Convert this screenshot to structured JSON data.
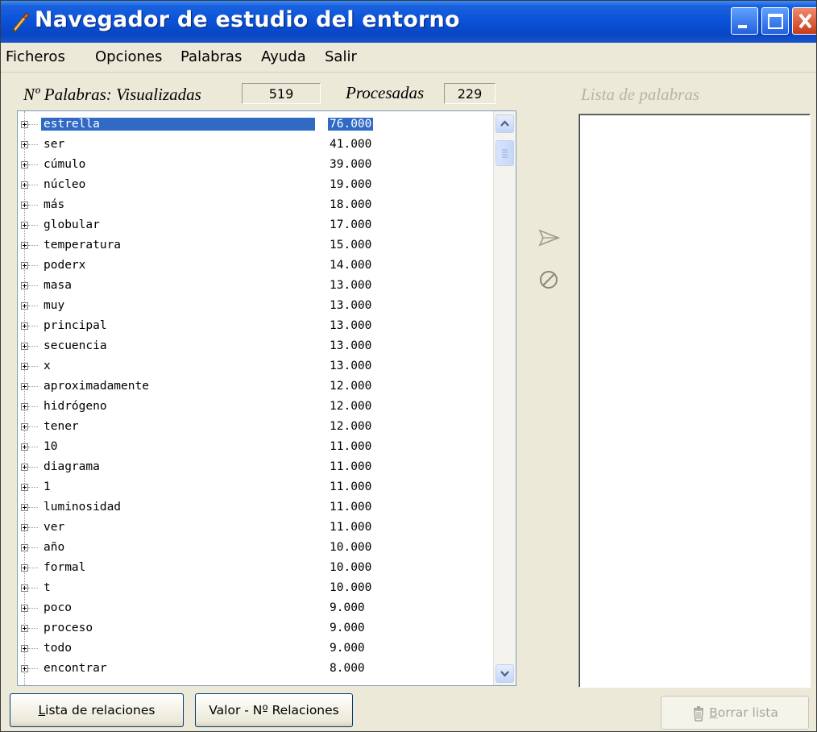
{
  "window": {
    "title": "Navegador de estudio del entorno"
  },
  "menu": {
    "items": [
      "Ficheros",
      "Opciones",
      "Palabras",
      "Ayuda",
      "Salir"
    ]
  },
  "counters": {
    "words_label": "Nº Palabras: Visualizadas",
    "visualized": "519",
    "processed_label": "Procesadas",
    "processed": "229"
  },
  "word_list": {
    "rows": [
      {
        "word": "estrella",
        "value": "76.000",
        "selected": true
      },
      {
        "word": "ser",
        "value": "41.000"
      },
      {
        "word": "cúmulo",
        "value": "39.000"
      },
      {
        "word": "núcleo",
        "value": "19.000"
      },
      {
        "word": "más",
        "value": "18.000"
      },
      {
        "word": "globular",
        "value": "17.000"
      },
      {
        "word": "temperatura",
        "value": "15.000"
      },
      {
        "word": "poderx",
        "value": "14.000"
      },
      {
        "word": "masa",
        "value": "13.000"
      },
      {
        "word": "muy",
        "value": "13.000"
      },
      {
        "word": "principal",
        "value": "13.000"
      },
      {
        "word": "secuencia",
        "value": "13.000"
      },
      {
        "word": "x",
        "value": "13.000"
      },
      {
        "word": "aproximadamente",
        "value": "12.000"
      },
      {
        "word": "hidrógeno",
        "value": "12.000"
      },
      {
        "word": "tener",
        "value": "12.000"
      },
      {
        "word": "10",
        "value": "11.000"
      },
      {
        "word": "diagrama",
        "value": "11.000"
      },
      {
        "word": "1",
        "value": "11.000"
      },
      {
        "word": "luminosidad",
        "value": "11.000"
      },
      {
        "word": "ver",
        "value": "11.000"
      },
      {
        "word": "año",
        "value": "10.000"
      },
      {
        "word": "formal",
        "value": "10.000"
      },
      {
        "word": "t",
        "value": "10.000"
      },
      {
        "word": "poco",
        "value": "9.000"
      },
      {
        "word": "proceso",
        "value": "9.000"
      },
      {
        "word": "todo",
        "value": "9.000"
      },
      {
        "word": "encontrar",
        "value": "8.000"
      }
    ]
  },
  "right_panel": {
    "title": "Lista de palabras"
  },
  "buttons": {
    "relations_list": {
      "label": "Lista de relaciones",
      "accel": "L",
      "rest": "ista de relaciones"
    },
    "value_relations": {
      "label": "Valor - Nº Relaciones"
    },
    "clear_list": {
      "label": "Borrar lista",
      "accel": "B",
      "rest": "orrar lista"
    }
  },
  "colors": {
    "selection": "#316ac5",
    "titlebar": "#0a53d9",
    "window_bg": "#ece9d8"
  },
  "icons": [
    "app-icon",
    "minimize-icon",
    "maximize-icon",
    "close-icon",
    "expand-icon",
    "scroll-up-icon",
    "scroll-down-icon",
    "send-arrow-icon",
    "cancel-icon",
    "trash-icon"
  ]
}
